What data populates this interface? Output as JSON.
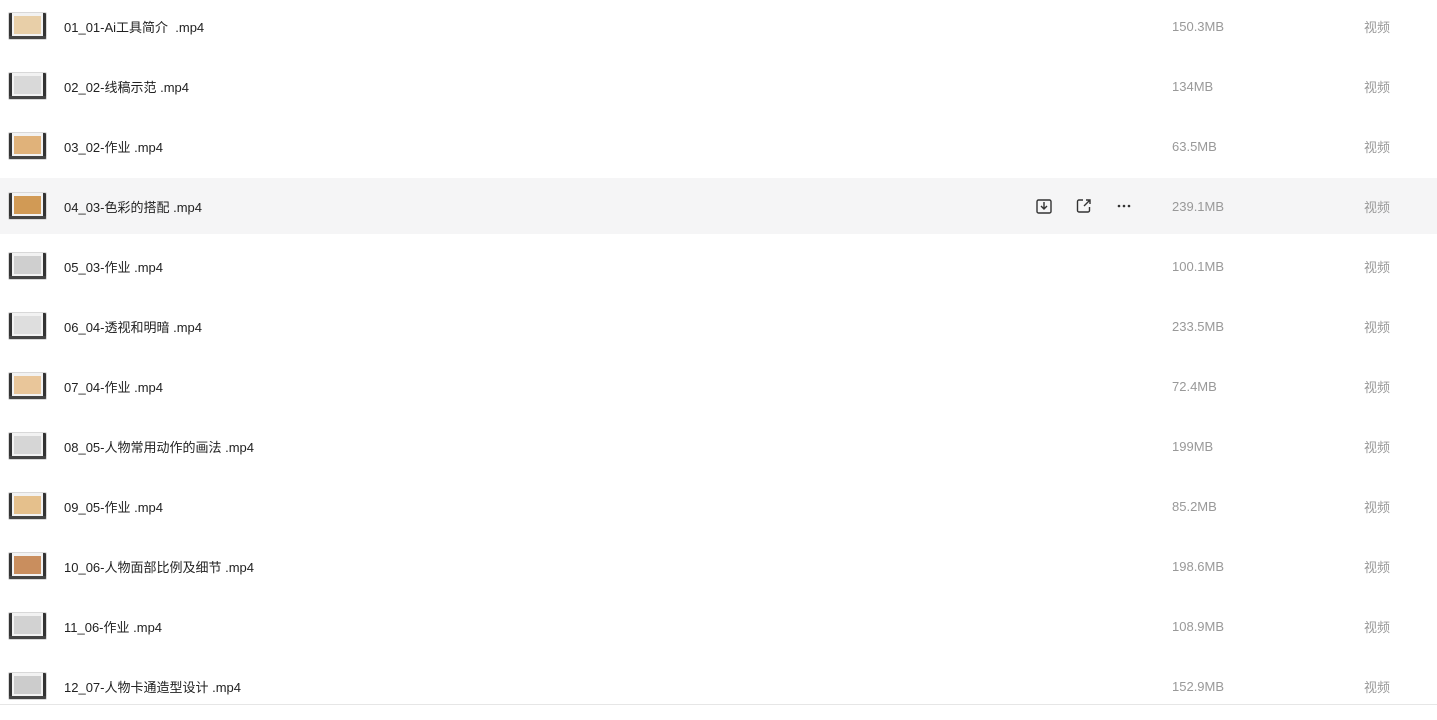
{
  "files": [
    {
      "name": "01_01-Ai工具简介  .mp4",
      "size": "150.3MB",
      "type": "视频",
      "thumb": "#e8cfa8"
    },
    {
      "name": "02_02-线稿示范 .mp4",
      "size": "134MB",
      "type": "视频",
      "thumb": "#d9d9d9"
    },
    {
      "name": "03_02-作业 .mp4",
      "size": "63.5MB",
      "type": "视频",
      "thumb": "#e0b27a"
    },
    {
      "name": "04_03-色彩的搭配 .mp4",
      "size": "239.1MB",
      "type": "视频",
      "thumb": "#d19a55"
    },
    {
      "name": "05_03-作业 .mp4",
      "size": "100.1MB",
      "type": "视频",
      "thumb": "#cfcfcf"
    },
    {
      "name": "06_04-透视和明暗 .mp4",
      "size": "233.5MB",
      "type": "视频",
      "thumb": "#dedede"
    },
    {
      "name": "07_04-作业 .mp4",
      "size": "72.4MB",
      "type": "视频",
      "thumb": "#e9c69a"
    },
    {
      "name": "08_05-人物常用动作的画法 .mp4",
      "size": "199MB",
      "type": "视频",
      "thumb": "#d6d6d6"
    },
    {
      "name": "09_05-作业 .mp4",
      "size": "85.2MB",
      "type": "视频",
      "thumb": "#e5c08c"
    },
    {
      "name": "10_06-人物面部比例及细节 .mp4",
      "size": "198.6MB",
      "type": "视频",
      "thumb": "#c98e5e"
    },
    {
      "name": "11_06-作业 .mp4",
      "size": "108.9MB",
      "type": "视频",
      "thumb": "#d2d2d2"
    },
    {
      "name": "12_07-人物卡通造型设计 .mp4",
      "size": "152.9MB",
      "type": "视频",
      "thumb": "#cccccc"
    }
  ],
  "hover_index": 3,
  "hover_actions": [
    {
      "name": "download-icon"
    },
    {
      "name": "share-icon"
    },
    {
      "name": "more-icon"
    }
  ],
  "footer_text": ""
}
